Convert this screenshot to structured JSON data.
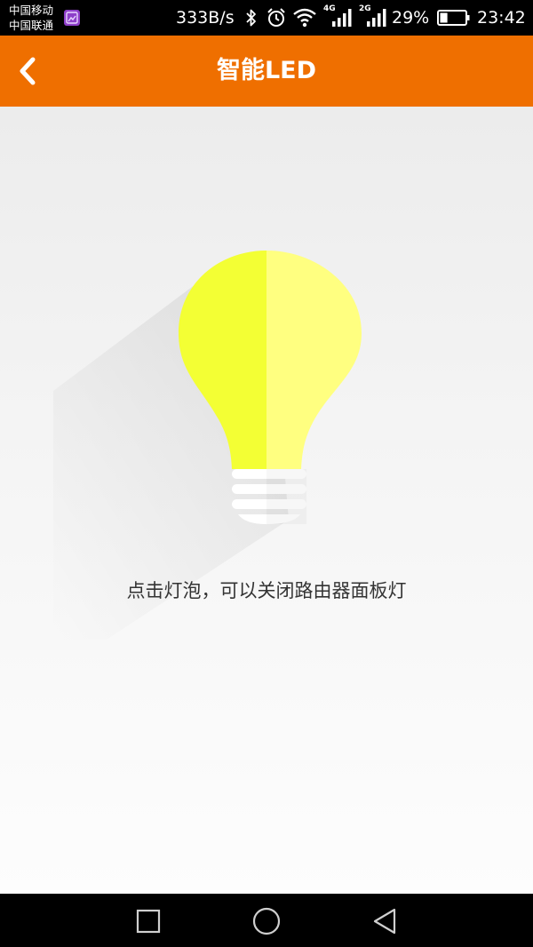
{
  "status_bar": {
    "carrier_1": "中国移动",
    "carrier_2": "中国联通",
    "net_speed": "333B/s",
    "net_type_1": "4G",
    "net_type_2": "2G",
    "battery_percent": "29%",
    "battery_level": 0.29,
    "time": "23:42",
    "icons": [
      "gallery-notification-icon",
      "bluetooth-icon",
      "alarm-icon",
      "wifi-icon",
      "signal-4g-icon",
      "signal-2g-icon",
      "battery-icon"
    ]
  },
  "app_bar": {
    "title": "智能LED",
    "back_icon": "chevron-left-icon",
    "color": "#ef6f00"
  },
  "main": {
    "bulb_colors": {
      "left": "#f3ff34",
      "right": "#ffff80",
      "base": "#ffffff"
    },
    "hint": "点击灯泡，可以关闭路由器面板灯"
  },
  "nav_bar": {
    "buttons": [
      "recent-apps-square-icon",
      "home-circle-icon",
      "back-triangle-icon"
    ]
  }
}
